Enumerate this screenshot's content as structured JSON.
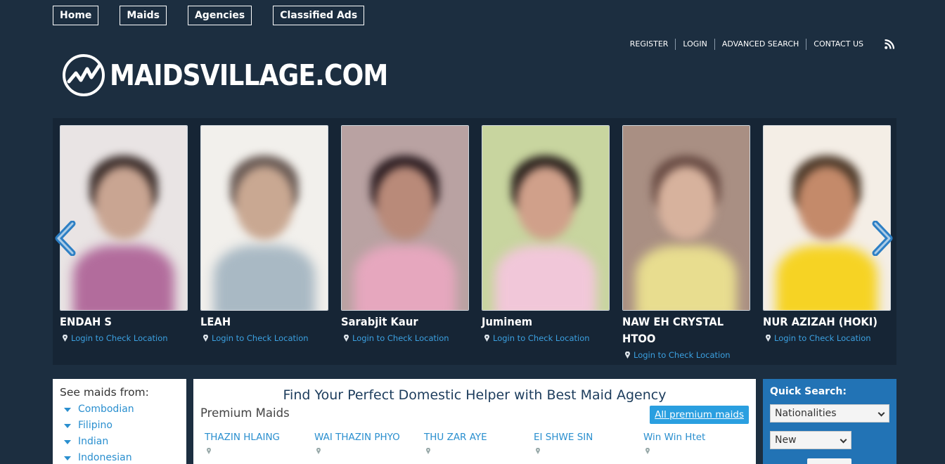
{
  "nav": [
    "Home",
    "Maids",
    "Agencies",
    "Classified Ads"
  ],
  "utility": [
    "REGISTER",
    "LOGIN",
    "ADVANCED SEARCH",
    "CONTACT US"
  ],
  "logo_text": "MAIDSVILLAGE.COM",
  "carousel": {
    "location_text": "Login to Check Location",
    "maids": [
      {
        "name": "ENDAH S",
        "palette": [
          "#e9e4e4",
          "#3d2f2c",
          "#c9a592",
          "#b26c9c"
        ]
      },
      {
        "name": "LEAH",
        "palette": [
          "#f2f0ec",
          "#6a5b55",
          "#c9a892",
          "#a9b9c4"
        ]
      },
      {
        "name": "Sarabjit Kaur",
        "palette": [
          "#b9a2a2",
          "#2e1f23",
          "#b98a79",
          "#e6a7be"
        ]
      },
      {
        "name": "Juminem",
        "palette": [
          "#c8d59f",
          "#2d241f",
          "#d0a08a",
          "#f1c7d9"
        ]
      },
      {
        "name": "NAW EH CRYSTAL HTOO",
        "palette": [
          "#a98f83",
          "#6a4d45",
          "#d7b29d",
          "#e8dd8f"
        ]
      },
      {
        "name": "NUR AZIZAH (HOKI)",
        "palette": [
          "#f4eee6",
          "#4e3a2a",
          "#c48a6a",
          "#f6d324"
        ]
      }
    ]
  },
  "see_maids": {
    "title": "See maids from:",
    "items": [
      "Combodian",
      "Filipino",
      "Indian",
      "Indonesian"
    ]
  },
  "main": {
    "heading": "Find Your Perfect Domestic Helper with Best Maid Agency",
    "subheading": "Premium Maids",
    "all_button": "All premium maids",
    "premium": [
      "THAZIN HLAING",
      "WAI THAZIN PHYO",
      "THU ZAR AYE",
      "EI SHWE SIN",
      "Win Win Htet"
    ]
  },
  "quick_search": {
    "title": "Quick Search:",
    "nationality": "Nationalities",
    "status": "New"
  },
  "colors": {
    "background": "#1c2e40",
    "accent": "#2a9fe0",
    "quick_search_bg": "#2273b5"
  }
}
